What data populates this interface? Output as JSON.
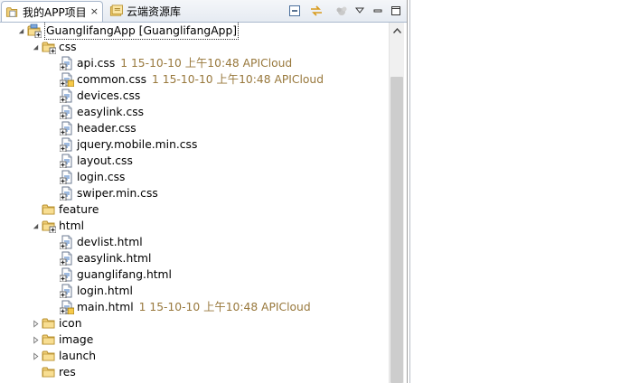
{
  "tabs": [
    {
      "label": "我的APP项目",
      "active": true,
      "icon": "project-folder-icon"
    },
    {
      "label": "云端资源库",
      "active": false,
      "icon": "cloud-library-icon"
    }
  ],
  "toolbar": {
    "collapse_icon": "collapse-all-icon",
    "link_icon": "link-with-editor-icon",
    "view_menu_icon": "view-menu-icon",
    "minimize_icon": "minimize-icon",
    "maximize_icon": "maximize-icon"
  },
  "tree": {
    "project": "GuanglifangApp [GuanglifangApp]",
    "css_folder": "css",
    "css_files": [
      {
        "name": "api.css",
        "deco": "1  15-10-10 上午10:48  APICloud"
      },
      {
        "name": "common.css",
        "deco": "1  15-10-10 上午10:48  APICloud"
      },
      {
        "name": "devices.css",
        "deco": ""
      },
      {
        "name": "easylink.css",
        "deco": ""
      },
      {
        "name": "header.css",
        "deco": ""
      },
      {
        "name": "jquery.mobile.min.css",
        "deco": ""
      },
      {
        "name": "layout.css",
        "deco": ""
      },
      {
        "name": "login.css",
        "deco": ""
      },
      {
        "name": "swiper.min.css",
        "deco": ""
      }
    ],
    "feature_folder": "feature",
    "html_folder": "html",
    "html_files": [
      {
        "name": "devlist.html",
        "deco": ""
      },
      {
        "name": "easylink.html",
        "deco": ""
      },
      {
        "name": "guanglifang.html",
        "deco": ""
      },
      {
        "name": "login.html",
        "deco": ""
      },
      {
        "name": "main.html",
        "deco": "1  15-10-10 上午10:48  APICloud"
      }
    ],
    "other_folders": [
      {
        "name": "icon",
        "expandable": true
      },
      {
        "name": "image",
        "expandable": true
      },
      {
        "name": "launch",
        "expandable": true
      },
      {
        "name": "res",
        "expandable": false
      }
    ]
  },
  "colors": {
    "decoration": "#98783c",
    "folder": "#e8c25a",
    "tab_border": "#a9b8cc"
  }
}
